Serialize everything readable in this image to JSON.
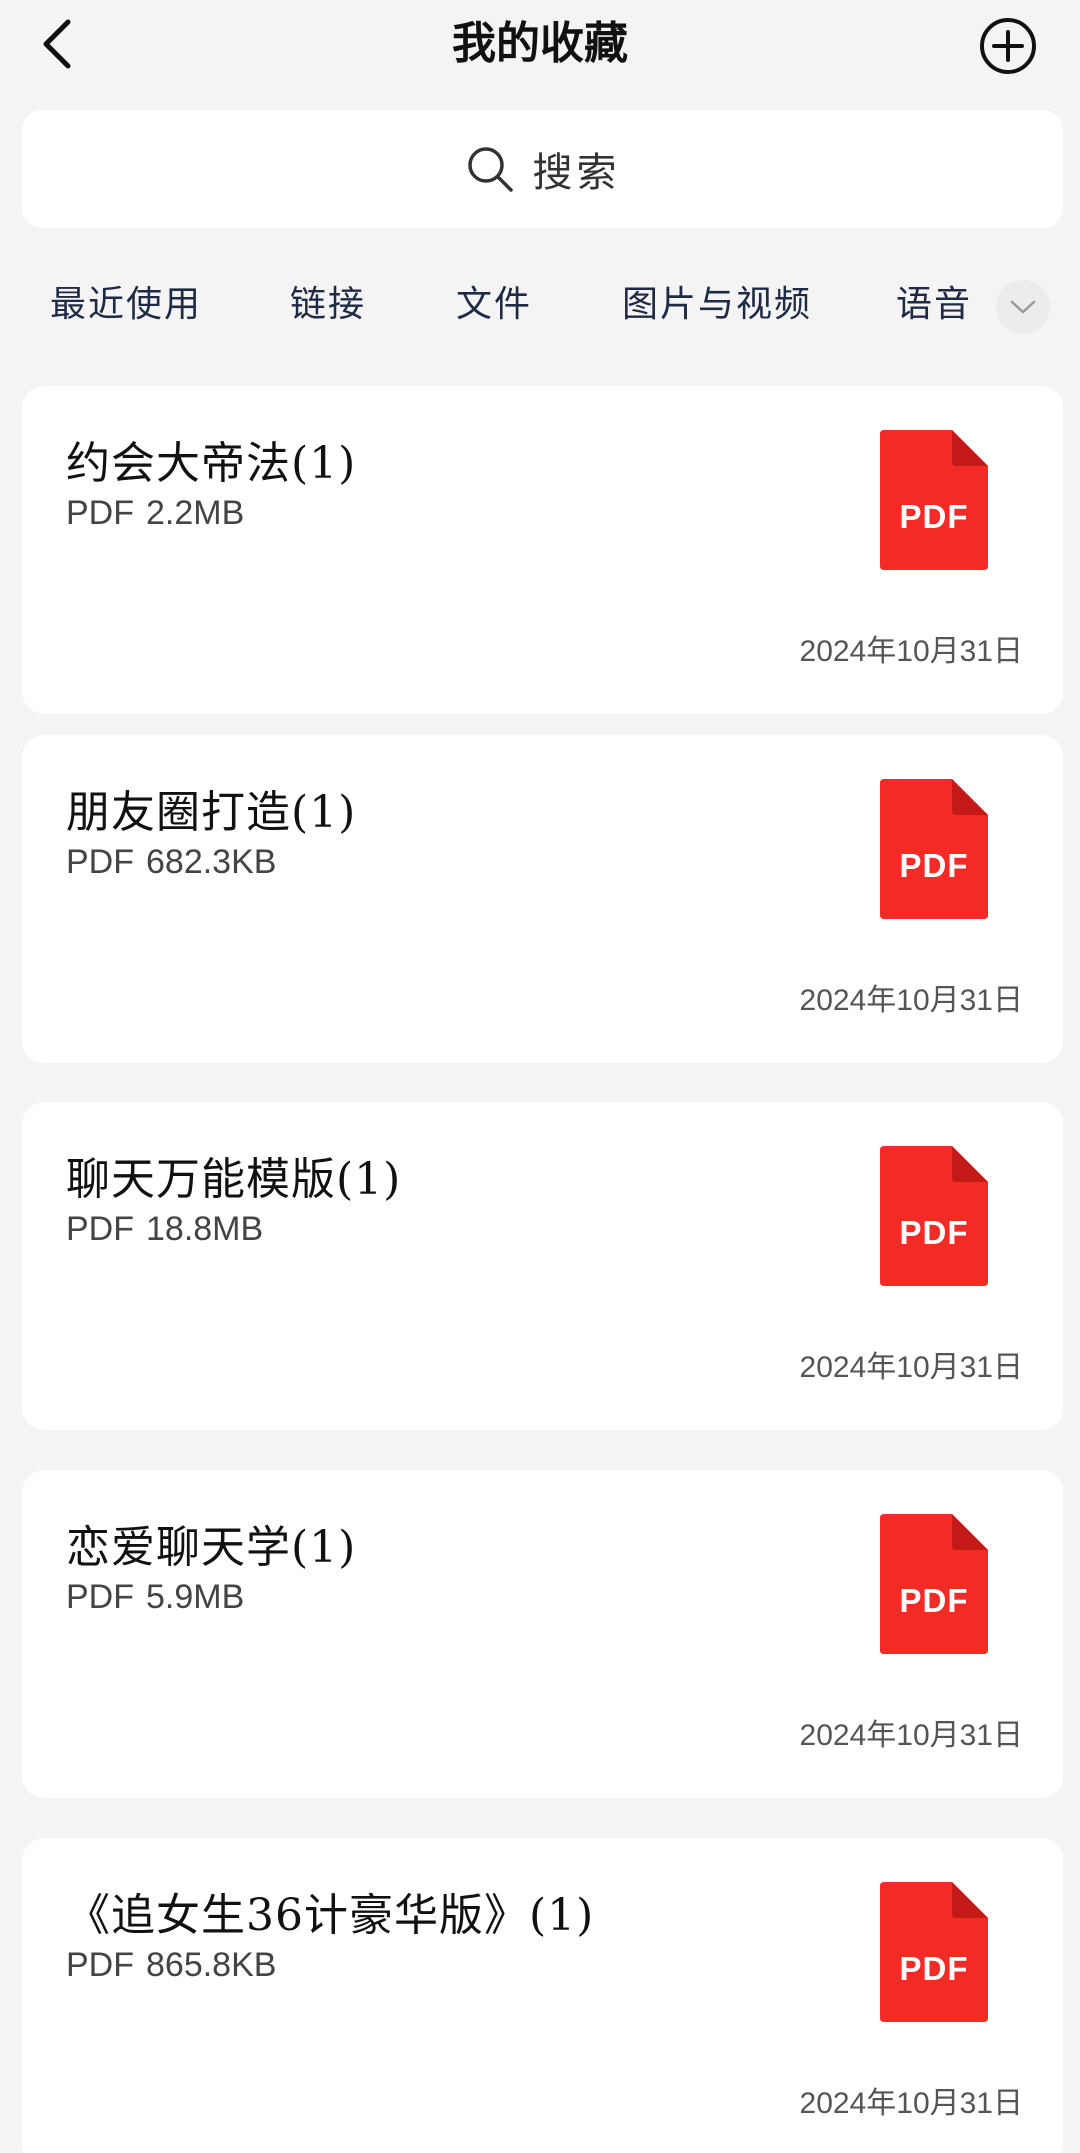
{
  "header": {
    "title": "我的收藏",
    "back_icon": "chevron-left-icon",
    "add_icon": "plus-circle-icon"
  },
  "search": {
    "placeholder": "搜索",
    "icon": "search-icon"
  },
  "tabs": [
    {
      "label": "最近使用"
    },
    {
      "label": "链接"
    },
    {
      "label": "文件"
    },
    {
      "label": "图片与视频"
    },
    {
      "label": "语音"
    }
  ],
  "tabs_expand_icon": "chevron-down-icon",
  "items": [
    {
      "title": "约会大帝法(1)",
      "type": "PDF",
      "size": "2.2MB",
      "date": "2024年10月31日",
      "icon_label": "PDF"
    },
    {
      "title": "朋友圈打造(1)",
      "type": "PDF",
      "size": "682.3KB",
      "date": "2024年10月31日",
      "icon_label": "PDF"
    },
    {
      "title": "聊天万能模版(1)",
      "type": "PDF",
      "size": "18.8MB",
      "date": "2024年10月31日",
      "icon_label": "PDF"
    },
    {
      "title": "恋爱聊天学(1)",
      "type": "PDF",
      "size": "5.9MB",
      "date": "2024年10月31日",
      "icon_label": "PDF"
    },
    {
      "title": "《追女生36计豪华版》(1)",
      "type": "PDF",
      "size": "865.8KB",
      "date": "2024年10月31日",
      "icon_label": "PDF"
    }
  ],
  "colors": {
    "pdf_red": "#f42a26",
    "pdf_fold": "#c41a17",
    "background": "#f4f4f4",
    "card": "#ffffff"
  }
}
